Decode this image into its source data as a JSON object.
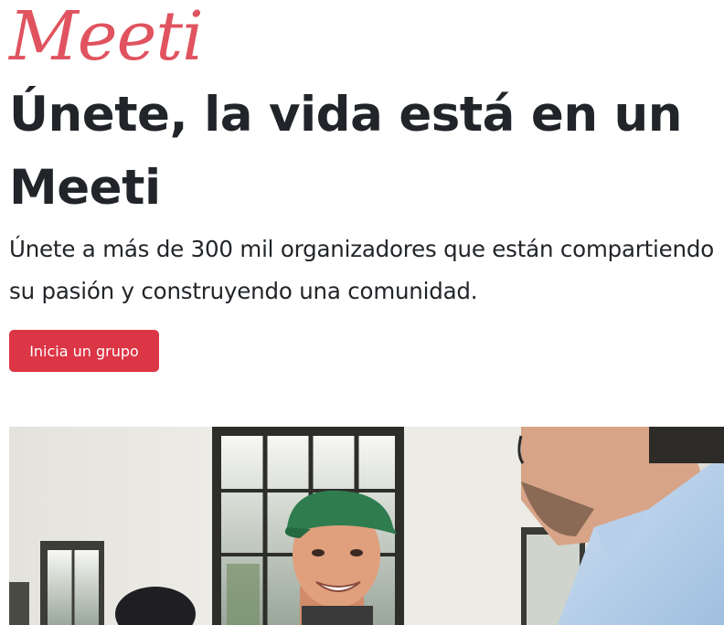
{
  "brand": {
    "logo_text": "Meeti",
    "accent_color": "#dc3545",
    "logo_color": "#e0535f"
  },
  "hero": {
    "headline": "Únete, la vida está en un Meeti",
    "lead": "Únete a más de 300 mil organizadores que están compartiendo su pasión y construyendo una comunidad.",
    "cta_label": "Inicia un grupo",
    "image_subject": "people-meeting-photo"
  }
}
